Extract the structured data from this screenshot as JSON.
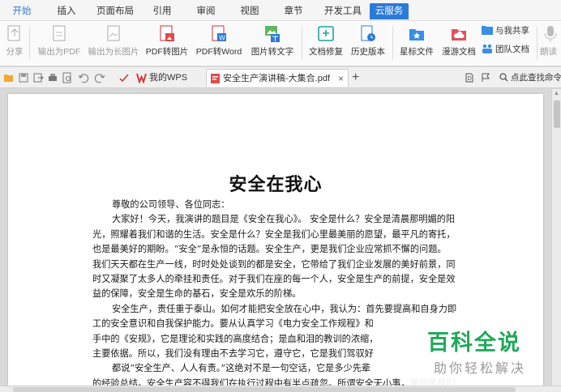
{
  "ribbon": {
    "tabs": [
      "开始",
      "插入",
      "页面布局",
      "引用",
      "审阅",
      "视图",
      "章节",
      "开发工具",
      "云服务"
    ],
    "active_tab": "云服务"
  },
  "toolbar": {
    "share": "分享",
    "export_pdf": "输出为PDF",
    "export_long_image": "输出为长图片",
    "pdf_to_image": "PDF转图片",
    "pdf_to_word": "PDF转Word",
    "image_to_text": "图片转文字",
    "doc_repair": "文档修复",
    "history": "历史版本",
    "starred_files": "星标文件",
    "roaming_docs": "漫游文档",
    "shared_with_me": "与我共享",
    "team_docs": "团队文档",
    "read_aloud": "朗读"
  },
  "quickbar": {
    "tabs": [
      {
        "label": "我的WPS",
        "close": "×"
      },
      {
        "label": "安全生产演讲稿-大集合.pdf",
        "close": "×"
      }
    ],
    "new_tab": "+",
    "search_label": "点此查找命令"
  },
  "document": {
    "title": "安全在我心",
    "lines": [
      "尊敬的公司领导、各位同志：",
      "大家好！今天，我演讲的题目是《安全在我心》。 安全是什么？安全是清晨那明媚的阳",
      "光，照耀着我们和谐的生活。安全是什么？安全是我们心里最美丽的愿望，最平凡的寄托，",
      "也是最美好的期盼。“安全”是永恒的话题。安全生产，更是我们企业应常抓不懈的问题。",
      "我们天天都在生产一线，时时处处谈到的都是安全，它带给了我们企业发展的美好前景，同",
      "时又凝聚了太多人的牵挂和责任。对于我们在座的每一个人，安全是生产的前提，安全是效",
      "益的保障，安全是生命的基石，安全是欢乐的阶梯。",
      "安全生产，责任重于泰山。如何才能把安全放在心中，我认为：首先要提高和自身力即",
      "工的安全意识和自我保护能力。要从认真学习《电力安全工作规程》和",
      "手中的《安规》，它是理论和实践的高度结合；是血和泪的教训的浓缩，",
      "主要依据。所以，我们没有理由不去学习它，遵守它，它是我们驾驭好",
      "都说“安全生产、人人有责。”这绝对不是一句空话，它是多少先辈",
      "的经验总结。安全生产容不得我们在执行过程中有半点疏忽。所谓安全无小事，哪怕是我们"
    ]
  },
  "watermark": {
    "main": "百科全说",
    "sub": "助你轻松解决"
  },
  "colors": {
    "accent": "#2b7ad9",
    "watermark_green": "#22a85b"
  }
}
